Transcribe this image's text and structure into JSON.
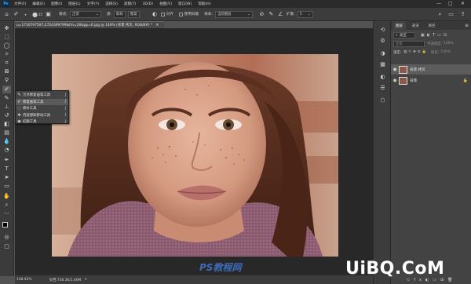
{
  "app": {
    "logo_text": "Ps"
  },
  "menu": [
    "文件(F)",
    "编辑(E)",
    "图像(I)",
    "图层(L)",
    "文字(Y)",
    "选择(S)",
    "滤镜(T)",
    "3D(D)",
    "视图(V)",
    "窗口(W)",
    "帮助(H)"
  ],
  "window_controls": {
    "minimize": "—",
    "maximize": "□",
    "close": "✕"
  },
  "options": {
    "brush_size": "25",
    "mode_label": "模式:",
    "mode_value": "正常",
    "source_sampled": "取样",
    "source_pattern": "图案",
    "aligned_label": "对齐",
    "use_legacy_label": "使用旧版",
    "sample_label": "样本:",
    "sample_value": "当前图层",
    "diffusion_label": "扩散:",
    "diffusion_value": "5"
  },
  "document": {
    "tab_title": "u=1716797597,2724399799&fm=26&gp=0.jpg @ 148% (背景 拷贝, RGB/8#) *",
    "close_label": "×"
  },
  "tool_flyout": {
    "items": [
      {
        "label": "污点修复画笔工具",
        "shortcut": "J",
        "icon": "spot-healing-icon",
        "glyph": "✎"
      },
      {
        "label": "修复画笔工具",
        "shortcut": "J",
        "icon": "healing-brush-icon",
        "glyph": "✐"
      },
      {
        "label": "修补工具",
        "shortcut": "J",
        "icon": "patch-icon",
        "glyph": "◌"
      },
      {
        "label": "内容感知移动工具",
        "shortcut": "J",
        "icon": "content-aware-move-icon",
        "glyph": "✥"
      },
      {
        "label": "红眼工具",
        "shortcut": "J",
        "icon": "red-eye-icon",
        "glyph": "◉"
      }
    ],
    "selected_index": 1
  },
  "status": {
    "zoom": "148.42%",
    "doc_info": "文档:738.3K/1.46M",
    "arrow": ">"
  },
  "layers_panel": {
    "tabs": [
      "图层",
      "通道",
      "路径"
    ],
    "active_tab": 0,
    "filter_label": "类型",
    "blend_mode": "正常",
    "opacity_label": "不透明度:",
    "opacity_value": "100%",
    "lock_label": "锁定:",
    "fill_label": "填充:",
    "fill_value": "100%",
    "layers": [
      {
        "name": "背景 拷贝",
        "selected": true
      },
      {
        "name": "背景",
        "selected": false
      }
    ]
  },
  "watermark": {
    "text": "PS教程网"
  },
  "site_logo": {
    "text": "UiBQ.CoM"
  }
}
